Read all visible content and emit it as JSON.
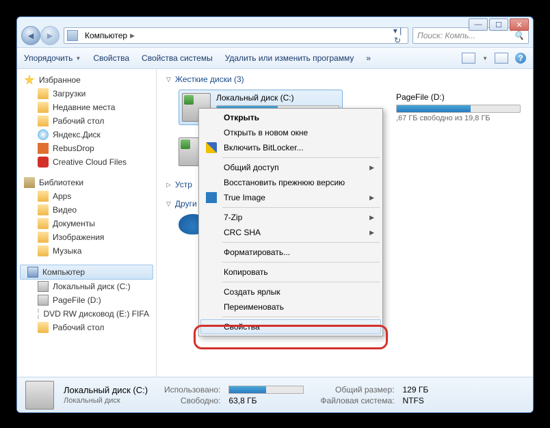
{
  "nav": {
    "breadcrumb": "Компьютер",
    "search_placeholder": "Поиск: Компь..."
  },
  "toolbar": {
    "organize": "Упорядочить",
    "properties": "Свойства",
    "system_properties": "Свойства системы",
    "uninstall": "Удалить или изменить программу"
  },
  "sidebar": {
    "favorites": "Избранное",
    "fav_items": [
      "Загрузки",
      "Недавние места",
      "Рабочий стол",
      "Яндекс.Диск",
      "RebusDrop",
      "Creative Cloud Files"
    ],
    "libraries": "Библиотеки",
    "lib_items": [
      "Apps",
      "Видео",
      "Документы",
      "Изображения",
      "Музыка"
    ],
    "computer": "Компьютер",
    "comp_items": [
      "Локальный диск (C:)",
      "PageFile (D:)",
      "DVD RW дисковод (E:) FIFA",
      "Рабочий стол"
    ]
  },
  "content": {
    "hard_disks": "Жесткие диски (3)",
    "devices": "Устр",
    "other": "Други",
    "drive_c": {
      "name": "Локальный диск (C:)"
    },
    "drive_d": {
      "name": "PageFile (D:)",
      "free": ",67 ГБ свободно из 19,8 ГБ"
    }
  },
  "ctx": {
    "open": "Открыть",
    "open_new": "Открыть в новом окне",
    "bitlocker": "Включить BitLocker...",
    "share": "Общий доступ",
    "restore": "Восстановить прежнюю версию",
    "true_image": "True Image",
    "seven_zip": "7-Zip",
    "crc": "CRC SHA",
    "format": "Форматировать...",
    "copy": "Копировать",
    "shortcut": "Создать ярлык",
    "rename": "Переименовать",
    "properties": "Свойства"
  },
  "status": {
    "name": "Локальный диск (C:)",
    "type": "Локальный диск",
    "used_label": "Использовано:",
    "free_label": "Свободно:",
    "free_val": "63,8 ГБ",
    "total_label": "Общий размер:",
    "total_val": "129 ГБ",
    "fs_label": "Файловая система:",
    "fs_val": "NTFS"
  }
}
